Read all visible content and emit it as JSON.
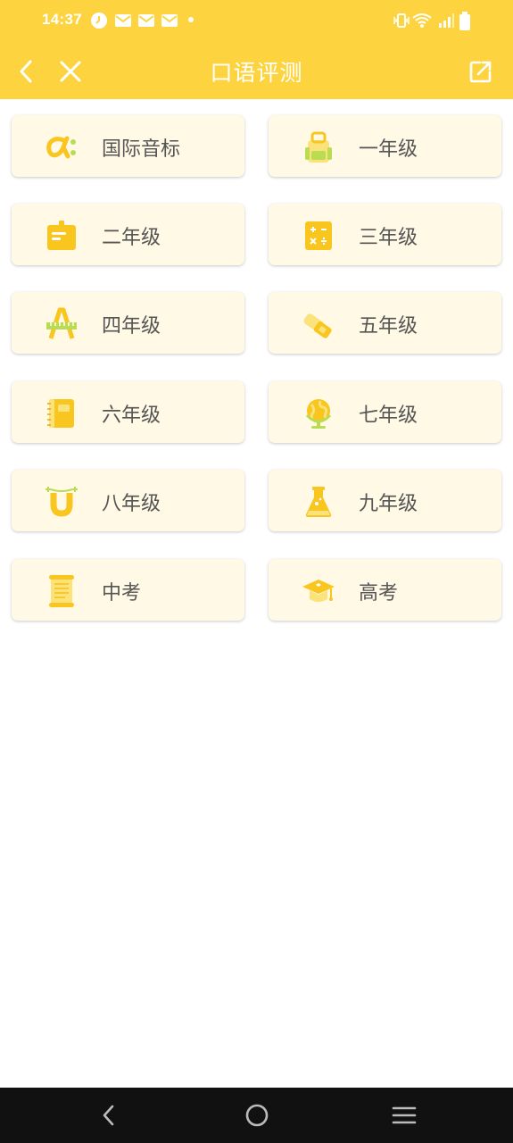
{
  "status_bar": {
    "time": "14:37",
    "left_icons": [
      "clock-icon",
      "mail-icon",
      "mail-icon",
      "mail-icon",
      "dot-icon"
    ],
    "right_icons": [
      "vibrate-icon",
      "wifi-icon",
      "signal-icon",
      "battery-icon"
    ]
  },
  "header": {
    "title": "口语评测",
    "back_icon": "back-chevron-icon",
    "close_icon": "close-icon",
    "share_icon": "share-icon",
    "color": "#FDD43F"
  },
  "categories": [
    {
      "label": "国际音标",
      "icon": "alpha-icon"
    },
    {
      "label": "一年级",
      "icon": "backpack-icon"
    },
    {
      "label": "二年级",
      "icon": "folder-icon"
    },
    {
      "label": "三年级",
      "icon": "calculator-icon"
    },
    {
      "label": "四年级",
      "icon": "ruler-a-icon"
    },
    {
      "label": "五年级",
      "icon": "eraser-icon"
    },
    {
      "label": "六年级",
      "icon": "notebook-icon"
    },
    {
      "label": "七年级",
      "icon": "globe-icon"
    },
    {
      "label": "八年级",
      "icon": "magnet-icon"
    },
    {
      "label": "九年级",
      "icon": "flask-icon"
    },
    {
      "label": "中考",
      "icon": "scroll-icon"
    },
    {
      "label": "高考",
      "icon": "graduation-cap-icon"
    }
  ],
  "bottom_nav": {
    "icons": [
      "nav-back-icon",
      "nav-home-icon",
      "nav-menu-icon"
    ]
  },
  "colors": {
    "accent": "#FDD43F",
    "card_bg": "#FFF9E6",
    "icon_yellow": "#F9C51F",
    "icon_light": "#FBE27A",
    "icon_green": "#B9DC53",
    "text": "#555555"
  }
}
